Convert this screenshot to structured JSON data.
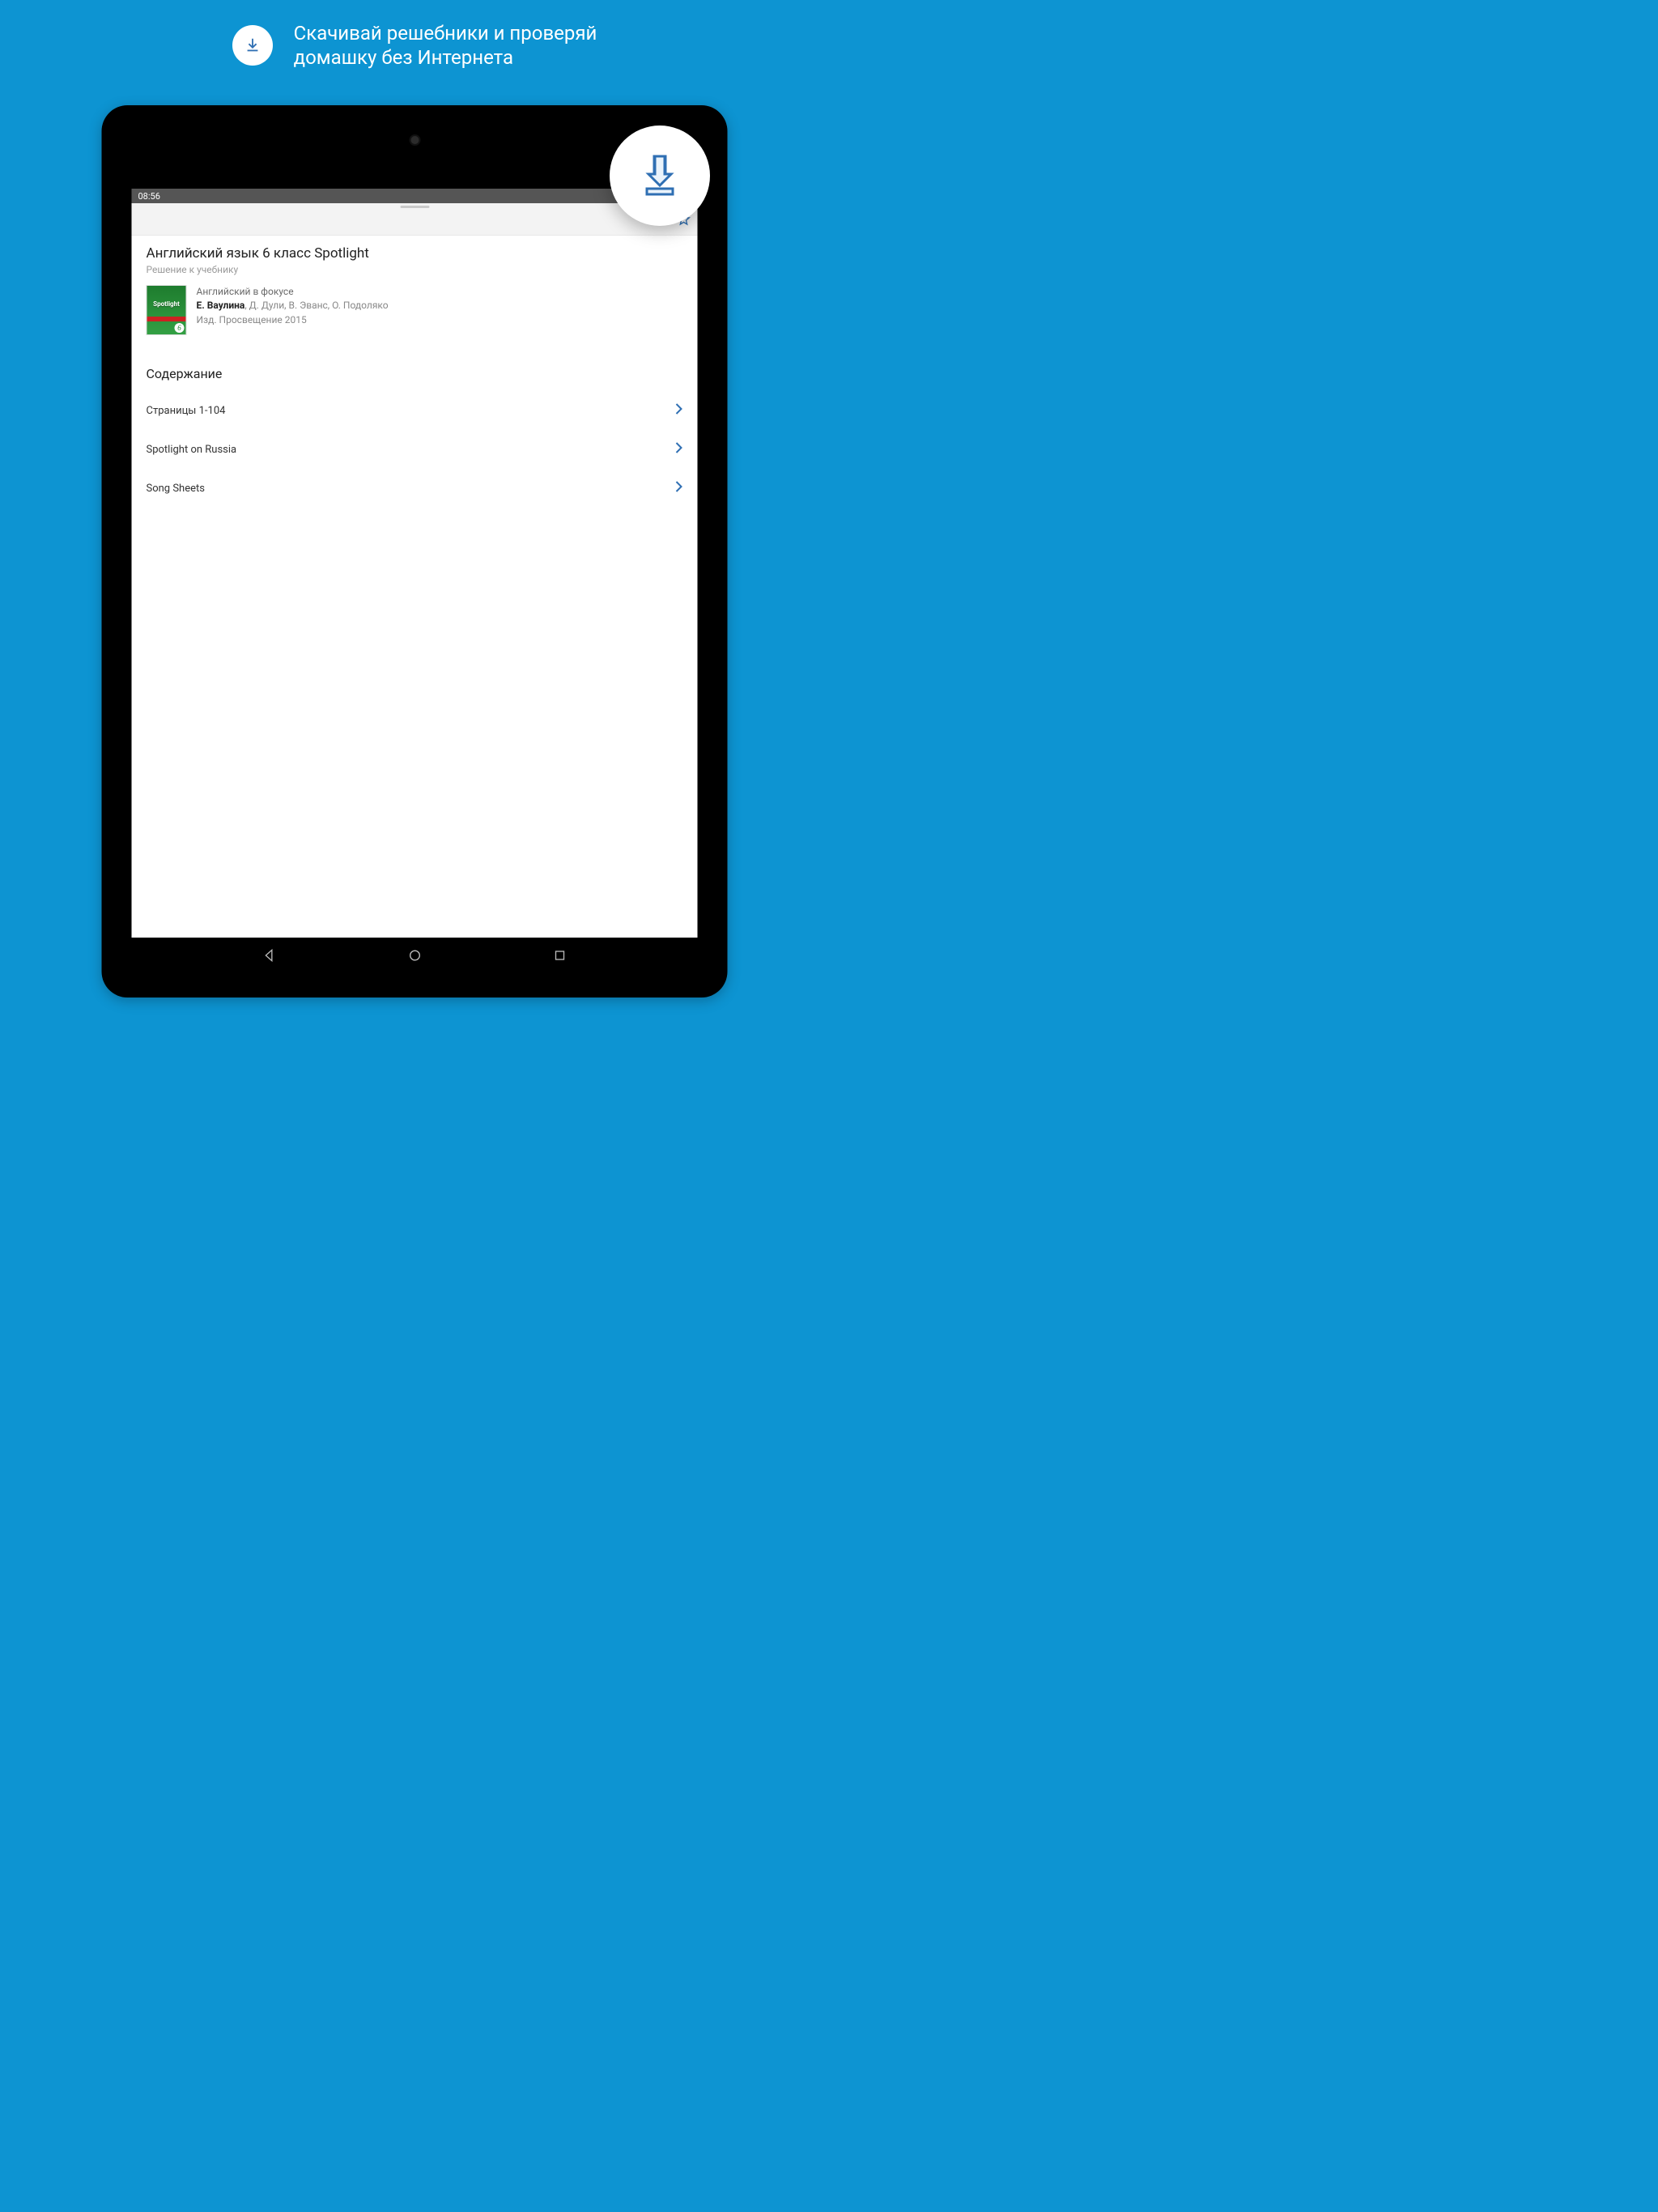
{
  "promo": {
    "line1": "Скачивай решебники и проверяй",
    "line2": "домашку без Интернета"
  },
  "statusbar": {
    "time": "08:56"
  },
  "page": {
    "title": "Английский язык 6 класс Spotlight",
    "subtitle": "Решение к учебнику"
  },
  "book": {
    "series": "Английский в фокусе",
    "author_main": "Е. Ваулина",
    "authors_rest": ", Д. Дули, В. Эванс, О. Подоляко",
    "publisher": "Изд. Просвещение 2015",
    "cover_label": "Spotlight",
    "cover_num": "6"
  },
  "contents": {
    "heading": "Содержание",
    "items": [
      "Страницы 1-104",
      "Spotlight on Russia",
      "Song Sheets"
    ]
  },
  "colors": {
    "accent": "#2f6fb3"
  }
}
